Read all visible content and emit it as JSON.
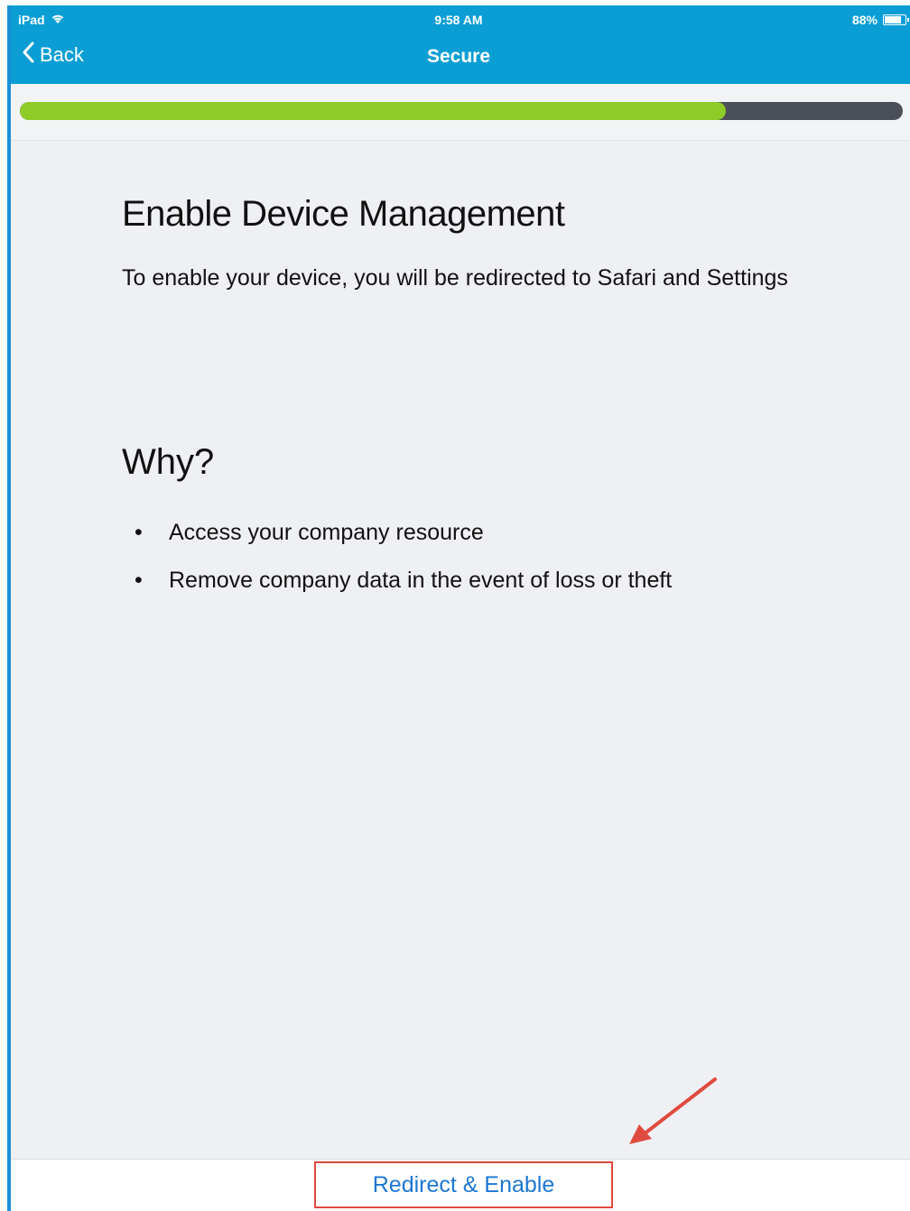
{
  "status_bar": {
    "device": "iPad",
    "time": "9:58 AM",
    "battery": "88%"
  },
  "nav": {
    "back_label": "Back",
    "title": "Secure"
  },
  "progress": {
    "fraction": 0.8
  },
  "main": {
    "heading": "Enable Device Management",
    "description": "To enable your device, you will be redirected to Safari and Settings",
    "why_heading": "Why?",
    "bullets": [
      "Access your company resource",
      "Remove company data in the event of loss or theft"
    ]
  },
  "footer": {
    "button_label": "Redirect & Enable"
  },
  "colors": {
    "nav_bar": "#0a9ed5",
    "progress_fill": "#8ecb27",
    "progress_track": "#4b4f57",
    "button_text": "#1d77d2",
    "highlight": "#e04a3f"
  }
}
